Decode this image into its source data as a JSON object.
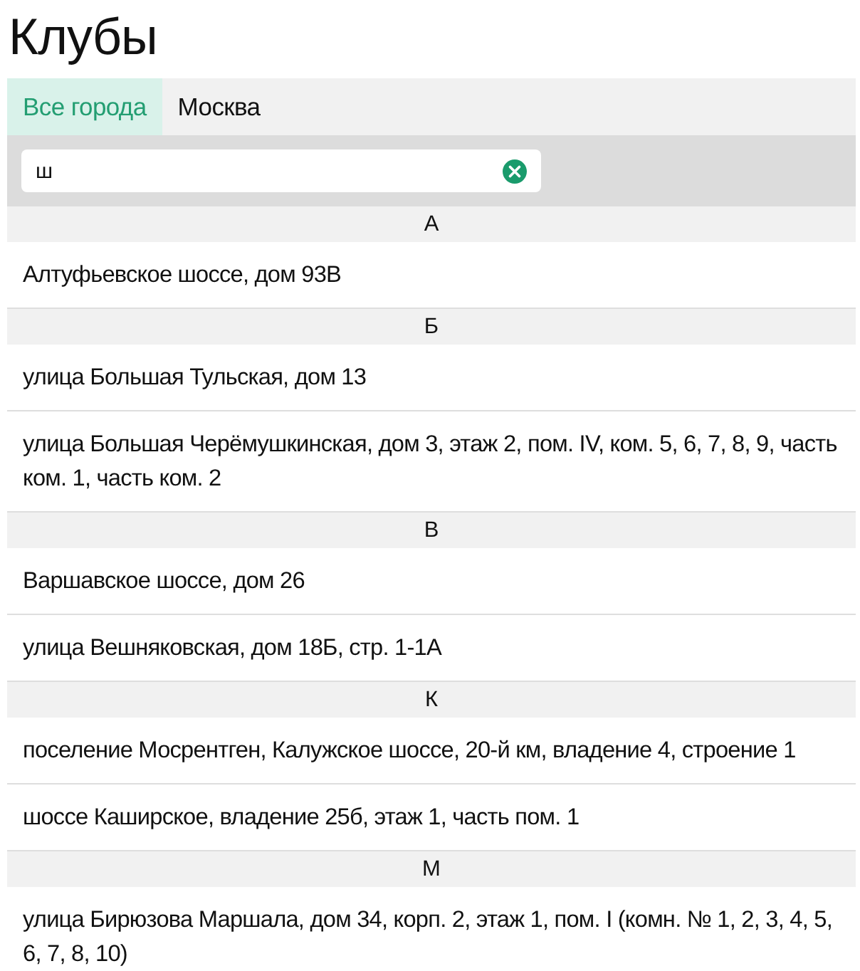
{
  "title": "Клубы",
  "tabs": [
    {
      "label": "Все города",
      "selected": true
    },
    {
      "label": "Москва",
      "selected": false
    }
  ],
  "search": {
    "value": "ш"
  },
  "groups": [
    {
      "letter": "А",
      "clubs": [
        "Алтуфьевское шоссе, дом 93В"
      ]
    },
    {
      "letter": "Б",
      "clubs": [
        "улица Большая Тульская, дом 13",
        "улица Большая Черёмушкинская, дом 3, этаж 2, пом. IV, ком. 5, 6, 7, 8, 9, часть ком. 1, часть ком. 2"
      ]
    },
    {
      "letter": "В",
      "clubs": [
        "Варшавское шоссе, дом 26",
        "улица Вешняковская, дом 18Б, стр. 1-1А"
      ]
    },
    {
      "letter": "К",
      "clubs": [
        "поселение Мосрентген, Калужское шоссе, 20-й км, владение 4, строение 1",
        "шоссе Каширское, владение 25б, этаж 1, часть пом. 1"
      ]
    },
    {
      "letter": "М",
      "clubs": [
        "улица Бирюзова Маршала, дом 34, корп. 2, этаж 1, пом. I (комн. № 1, 2, 3, 4, 5, 6, 7, 8, 10)"
      ]
    }
  ]
}
